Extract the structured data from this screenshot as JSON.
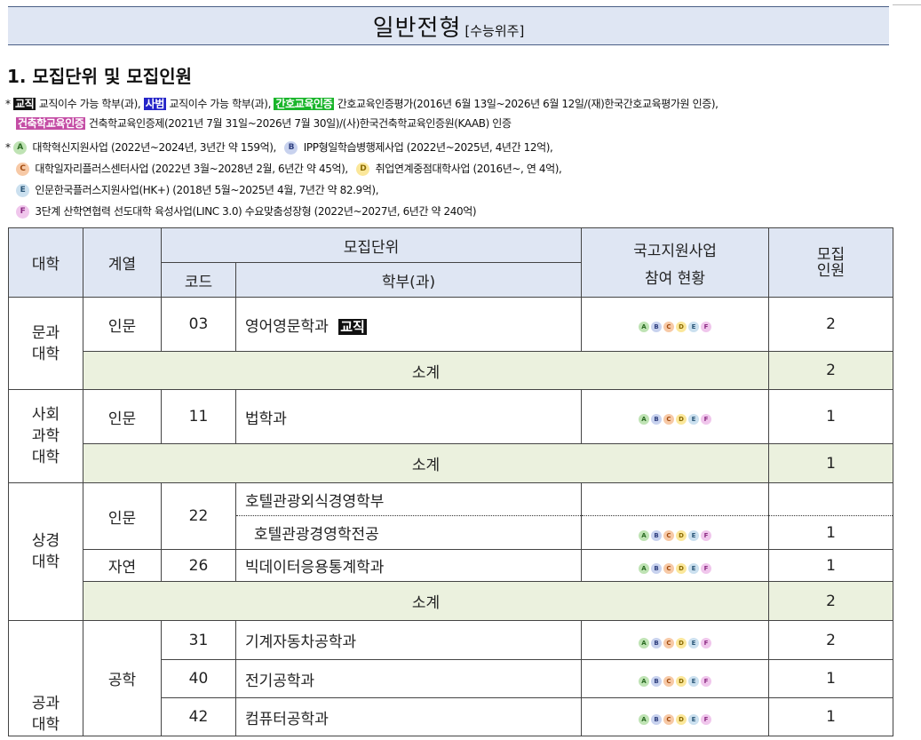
{
  "banner": {
    "title": "일반전형",
    "subtitle": "[수능위주]"
  },
  "heading": "1. 모집단위 및 모집인원",
  "notes": {
    "bullet": "*",
    "line1": {
      "tag_teach": "교직",
      "t1": "교직이수 가능 학부(과),",
      "tag_librarian": "사범",
      "t2": "교직이수 가능 학부(과),",
      "tag_nursing": "간호교육인증",
      "t3": "간호교육인증평가(2016년 6월 13일~2026년 6월 12일/(재)한국간호교육평가원 인증),"
    },
    "line2": {
      "tag_arch": "건축학교육인증",
      "t4": "건축학교육인증제(2021년 7월 31일~2026년 7월 30일)/(사)한국건축학교육인증원(KAAB) 인증"
    },
    "projects": [
      {
        "letter": "A",
        "text": "대학혁신지원사업 (2022년~2024년, 3년간 약 159억),"
      },
      {
        "letter": "B",
        "text": "IPP형일학습병행제사업 (2022년~2025년, 4년간 12억),"
      },
      {
        "letter": "C",
        "text": "대학일자리플러스센터사업 (2022년 3월~2028년 2월, 6년간 약 45억),"
      },
      {
        "letter": "D",
        "text": "취업연계중점대학사업 (2016년~, 연 4억),"
      },
      {
        "letter": "E",
        "text": "인문한국플러스지원사업(HK+) (2018년 5월~2025년 4월, 7년간 약 82.9억),"
      },
      {
        "letter": "F",
        "text": "3단계 산학연협력 선도대학 육성사업(LINC 3.0) 수요맞춤성장형 (2022년~2027년, 6년간 약 240억)"
      }
    ]
  },
  "table": {
    "headers": {
      "college": "대학",
      "track": "계열",
      "unit": "모집단위",
      "code": "코드",
      "dept": "학부(과)",
      "project_l1": "국고지원사업",
      "project_l2": "참여 현황",
      "quota_l1": "모집",
      "quota_l2": "인원"
    },
    "dot_letters": [
      "A",
      "B",
      "C",
      "D",
      "E",
      "F"
    ],
    "subtotal_label": "소계",
    "humanities": {
      "college": [
        "문과",
        "대학"
      ],
      "track": "인문",
      "code": "03",
      "dept": "영어영문학과",
      "tag": "교직",
      "quota": "2",
      "subtotal": "2"
    },
    "social": {
      "college": [
        "사회",
        "과학",
        "대학"
      ],
      "track": "인문",
      "code": "11",
      "dept": "법학과",
      "quota": "1",
      "subtotal": "1"
    },
    "business": {
      "college": [
        "상경",
        "대학"
      ],
      "track_a": "인문",
      "code_a": "22",
      "dept_a": "호텔관광외식경영학부",
      "dept_a_major": "호텔관광경영학전공",
      "quota_a": "1",
      "track_b": "자연",
      "code_b": "26",
      "dept_b": "빅데이터응용통계학과",
      "quota_b": "1",
      "subtotal": "2"
    },
    "engineering": {
      "college": [
        "공과",
        "대학"
      ],
      "track": "공학",
      "rows": [
        {
          "code": "31",
          "dept": "기계자동차공학과",
          "quota": "2"
        },
        {
          "code": "40",
          "dept": "전기공학과",
          "quota": "1"
        },
        {
          "code": "42",
          "dept": "컴퓨터공학과",
          "quota": "1"
        }
      ]
    }
  }
}
